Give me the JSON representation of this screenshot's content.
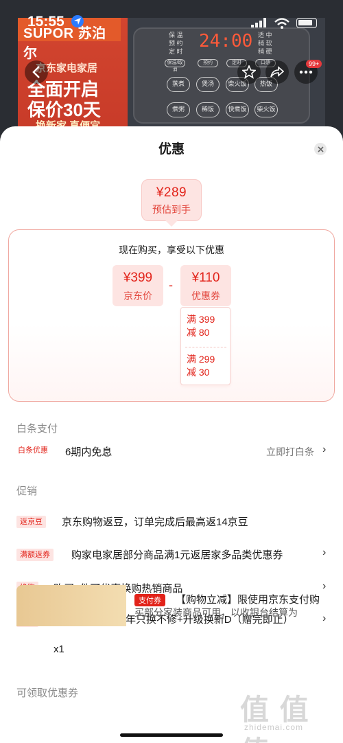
{
  "status_bar": {
    "time": "15:55"
  },
  "product_image": {
    "brand": "SUPOR 苏泊尔",
    "banner_line1": "京东家电家居",
    "banner_line2": "全面开启",
    "banner_line3": "保价30天",
    "banner_line4": "换新家 真便宜",
    "panel_time": "24:00",
    "panel_left_labels": [
      "保 温",
      "预 约",
      "定 时"
    ],
    "panel_right_labels": [
      "适 中",
      "稍 软",
      "稍 硬"
    ],
    "panel_small_buttons": [
      "保温/取消",
      "预约",
      "定时",
      "口感"
    ],
    "panel_buttons_row1": [
      "蒸煮",
      "煲汤",
      "柴火饭",
      "热饭"
    ],
    "panel_buttons_row2": [
      "煮粥",
      "稀饭",
      "快煮饭",
      "柴火饭"
    ],
    "cart_badge": "99+"
  },
  "sheet": {
    "title": "优惠",
    "final_price": "¥289",
    "final_label": "预估到手",
    "calc_title": "现在购买，享受以下优惠",
    "jd_price": "¥399",
    "jd_price_label": "京东价",
    "coupon_value": "¥110",
    "coupon_label": "优惠券",
    "minus": "-",
    "tiers": [
      {
        "line1": "满 399",
        "line2": "减 80"
      },
      {
        "line1": "满 299",
        "line2": "减 30"
      }
    ]
  },
  "baitiao": {
    "header": "白条支付",
    "tag": "白条优惠",
    "text": "6期内免息",
    "link": "立即打白条",
    "chevron": "›"
  },
  "promo": {
    "header": "促销",
    "items": [
      {
        "tag": "返京豆",
        "text": "京东购物返豆，订单完成后最高返14京豆",
        "chevron": ""
      },
      {
        "tag": "满额返券",
        "text": "购家电家居部分商品满1元返居家多品类优惠券",
        "chevron": "›"
      },
      {
        "tag": "换购",
        "text": "购买1件可优惠换购热销商品",
        "chevron": "›"
      },
      {
        "tag": "赠品",
        "text": "【京服无忧】首年只换不修+升级换新D（赠完即止）",
        "extra": "x1",
        "chevron": "›"
      }
    ]
  },
  "coupons": {
    "header": "可领取优惠券",
    "tag": "支付券",
    "text": "【购物立减】限使用京东支付购",
    "text2": "买部分家装商品可用，以收银台结算为"
  },
  "watermark": {
    "main": "值 值 值",
    "sub": "zhidemai.com"
  }
}
